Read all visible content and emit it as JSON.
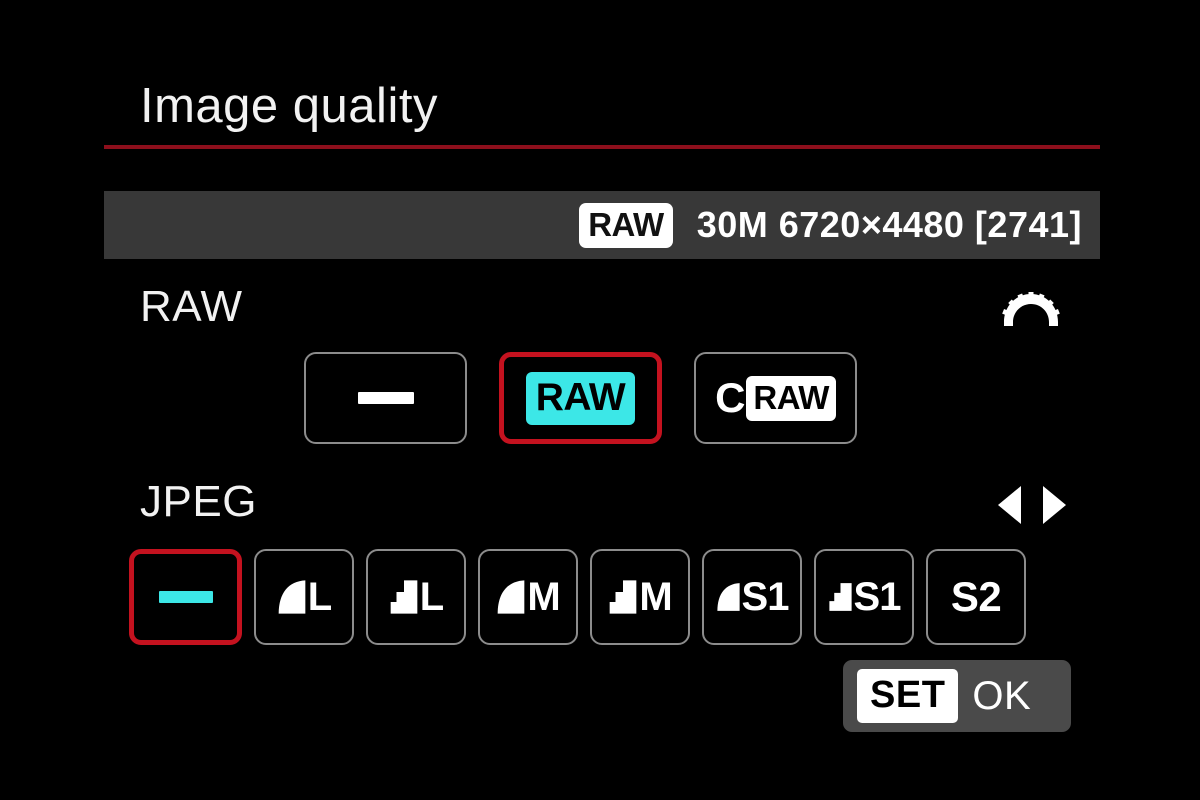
{
  "screen": {
    "title": "Image quality",
    "background_color": "#000000",
    "accent_rule_color": "#8d0f1c",
    "selection_color": "#c4121f",
    "highlight_color": "#3ce7e7"
  },
  "info_bar": {
    "format_badge": "RAW",
    "details": "30M 6720×4480 [2741]"
  },
  "raw_section": {
    "label": "RAW",
    "control_hint_icon": "main-dial-icon",
    "options": [
      {
        "id": "none",
        "label": "—",
        "type": "dash",
        "selected": false
      },
      {
        "id": "raw",
        "label": "RAW",
        "type": "badge",
        "selected": true
      },
      {
        "id": "craw",
        "label": "CRAW",
        "prefix": "C",
        "badge": "RAW",
        "type": "badge-prefixed",
        "selected": false
      }
    ]
  },
  "jpeg_section": {
    "label": "JPEG",
    "control_hint_icon": "left-right-arrows-icon",
    "options": [
      {
        "id": "none",
        "label": "—",
        "quality": "",
        "size": "",
        "type": "dash",
        "selected": true
      },
      {
        "id": "fine-l",
        "label": "Fine L",
        "quality": "fine",
        "size": "L",
        "type": "quality",
        "selected": false
      },
      {
        "id": "normal-l",
        "label": "Normal L",
        "quality": "normal",
        "size": "L",
        "type": "quality",
        "selected": false
      },
      {
        "id": "fine-m",
        "label": "Fine M",
        "quality": "fine",
        "size": "M",
        "type": "quality",
        "selected": false
      },
      {
        "id": "normal-m",
        "label": "Normal M",
        "quality": "normal",
        "size": "M",
        "type": "quality",
        "selected": false
      },
      {
        "id": "fine-s1",
        "label": "Fine S1",
        "quality": "fine",
        "size": "S1",
        "type": "quality",
        "selected": false
      },
      {
        "id": "normal-s1",
        "label": "Normal S1",
        "quality": "normal",
        "size": "S1",
        "type": "quality",
        "selected": false
      },
      {
        "id": "s2",
        "label": "S2",
        "quality": "",
        "size": "S2",
        "type": "text",
        "selected": false
      }
    ]
  },
  "footer": {
    "set_label": "SET",
    "ok_label": "OK"
  }
}
